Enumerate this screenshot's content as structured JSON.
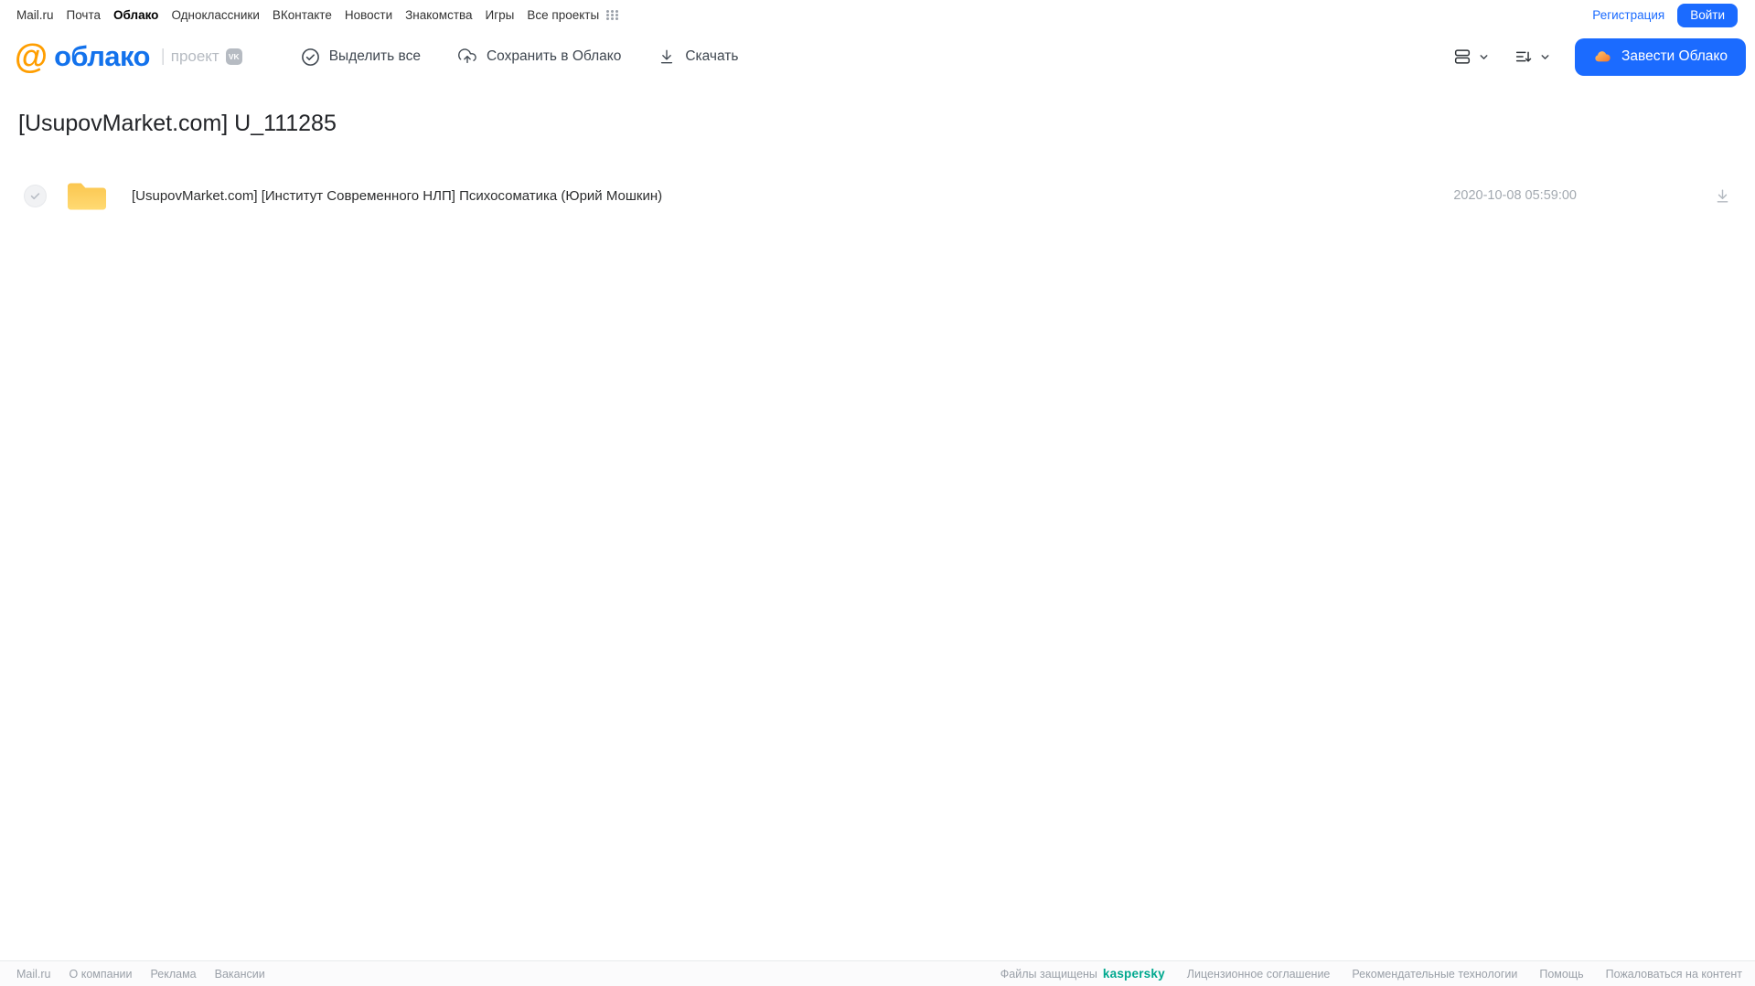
{
  "topnav": {
    "items": [
      "Mail.ru",
      "Почта",
      "Облако",
      "Одноклассники",
      "ВКонтакте",
      "Новости",
      "Знакомства",
      "Игры",
      "Все проекты"
    ],
    "register_label": "Регистрация",
    "login_label": "Войти"
  },
  "toolbar": {
    "logo_text": "облако",
    "project_label": "проект",
    "vk_badge_label": "VK",
    "select_all_label": "Выделить все",
    "save_to_cloud_label": "Сохранить в Облако",
    "download_label": "Скачать",
    "get_cloud_label": "Завести Облако"
  },
  "main": {
    "title": "[UsupovMarket.com] U_111285",
    "files": [
      {
        "name": "[UsupovMarket.com] [Институт Современного НЛП] Психосоматика (Юрий Мошкин)",
        "date": "2020-10-08 05:59:00",
        "type": "folder"
      }
    ]
  },
  "footer": {
    "links_left": [
      "Mail.ru",
      "О компании",
      "Реклама",
      "Вакансии"
    ],
    "protected_label": "Файлы защищены",
    "kaspersky_label": "kaspersky",
    "links_right": [
      "Лицензионное соглашение",
      "Рекомендательные технологии",
      "Помощь",
      "Пожаловаться на контент"
    ]
  },
  "colors": {
    "accent_blue": "#1b6bff",
    "logo_blue": "#1372ec",
    "logo_orange": "#ff9e00",
    "folder_yellow": "#ffd15c",
    "kaspersky_teal": "#00a88e",
    "muted_gray": "#9aa0a8"
  },
  "icons": {
    "apps": "grid-dots",
    "at_logo": "at-sign",
    "vk": "vk-badge",
    "select_all": "check-circle",
    "save_to_cloud": "cloud-upload",
    "download": "arrow-down-to-line",
    "view_mode": "list-rows",
    "sort": "sort-lines",
    "chevron": "chevron-down",
    "cloud_button": "cloud",
    "file": "folder",
    "row_check": "check"
  }
}
